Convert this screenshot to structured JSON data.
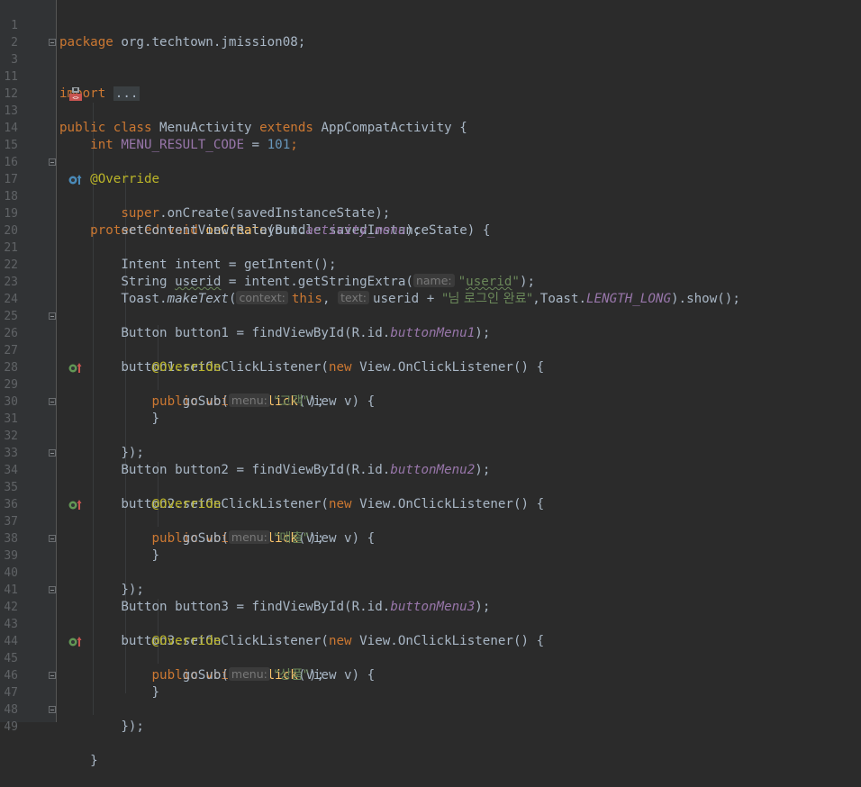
{
  "editor": {
    "colors": {
      "background": "#2b2b2b",
      "gutter": "#313335",
      "keyword": "#cc7832",
      "string": "#6a8759",
      "number": "#6897bb",
      "method": "#ffc66d",
      "annotation": "#bbb529",
      "field": "#9876aa",
      "text": "#a9b7c6"
    },
    "line_numbers": [
      "1",
      "2",
      "3",
      "11",
      "12",
      "13",
      "14",
      "15",
      "16",
      "17",
      "18",
      "19",
      "20",
      "21",
      "22",
      "23",
      "24",
      "25",
      "26",
      "27",
      "28",
      "29",
      "30",
      "31",
      "32",
      "33",
      "34",
      "35",
      "36",
      "37",
      "38",
      "39",
      "40",
      "41",
      "42",
      "43",
      "44",
      "45",
      "46",
      "47",
      "48",
      "49"
    ],
    "gutter_icons": {
      "class_icon": "android-layout-icon",
      "override_up": "override-method-icon",
      "implement_up": "implement-method-icon"
    },
    "tokens": {
      "package_kw": "package",
      "package_name": " org.techtown.jmission08;",
      "import_kw": "import",
      "import_folded": "...",
      "public": "public",
      "class": "class",
      "class_name": " MenuActivity ",
      "extends": "extends",
      "super_class": " AppCompatActivity {",
      "int": "int",
      "const_name": "MENU_RESULT_CODE",
      "eq": " = ",
      "const_val": "101",
      "semi": ";",
      "override": "@Override",
      "protected": "protected",
      "void": "void",
      "oncreate": "onCreate",
      "oncreate_args": "(Bundle savedInstanceState) {",
      "super": "super",
      "super_call": ".onCreate(savedInstanceState);",
      "setcontent": "setContentView(R.layout.",
      "activity_menu": "activity_menu",
      "close_paren_semi": ");",
      "intent_line": "Intent intent = getIntent();",
      "string_decl": "String ",
      "userid": "userid",
      "getstring": " = intent.getStringExtra(",
      "hint_name": "name:",
      "userid_str_open": "\"",
      "userid_str_word": "userid",
      "userid_str_close": "\"",
      "toast": "Toast.",
      "maketext": "makeText",
      "paren_open": "(",
      "hint_context": "context:",
      "this": "this",
      "comma_space": ", ",
      "hint_text": "text:",
      "userid_plus": "userid + ",
      "login_str": "\"님 로그인 완료\"",
      "toast_len": ",Toast.",
      "length_long": "LENGTH_LONG",
      "show": ").show();",
      "button1_decl": "Button button1 = findViewById(R.id.",
      "button1_id": "buttonMenu1",
      "button2_decl": "Button button2 = findViewById(R.id.",
      "button2_id": "buttonMenu2",
      "button3_decl": "Button button3 = findViewById(R.id.",
      "button3_id": "buttonMenu3",
      "b1_listener": "button1.setOnClickListener(",
      "b2_listener": "button2.setOnClickListener(",
      "b3_listener": "button3.setOnClickListener(",
      "new": "new",
      "onclick_class": " View.OnClickListener() {",
      "onclick": "onClick",
      "onclick_args": "(View v) {",
      "gosub": "goSub(",
      "hint_menu": "menu:",
      "str_customer": "\"고객\"",
      "str_sales": "\"매출\"",
      "str_product": "\"상품\"",
      "brace_close": "}",
      "brace_paren_close": "});"
    }
  }
}
